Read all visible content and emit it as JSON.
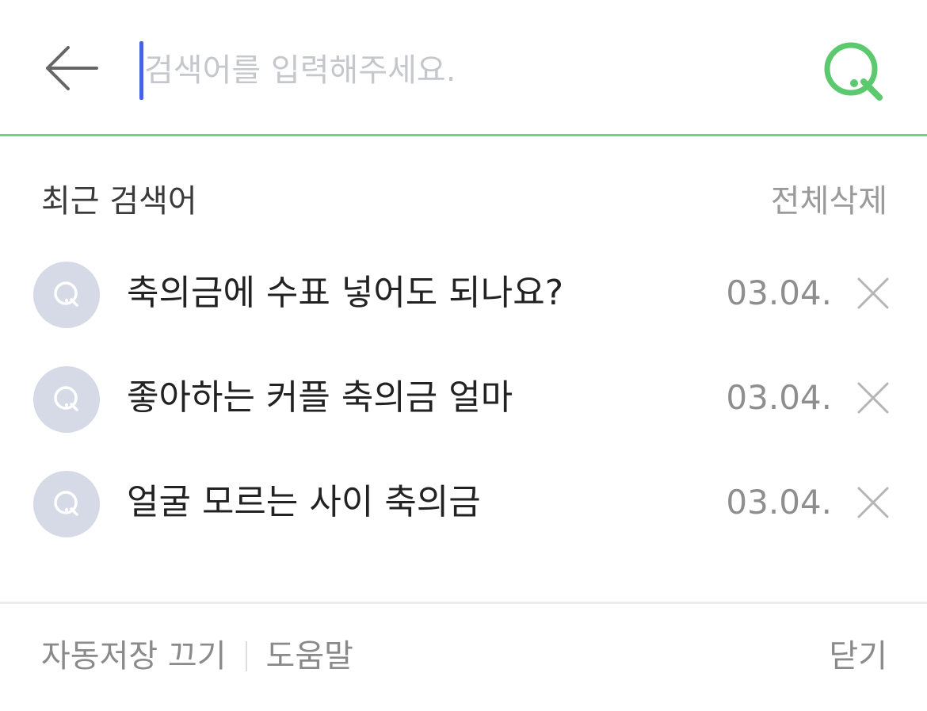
{
  "search": {
    "placeholder": "검색어를 입력해주세요.",
    "value": "",
    "back_icon": "arrow-left-icon",
    "search_icon": "search-icon",
    "accent_color": "#5cc96f",
    "caret_color": "#4563e3"
  },
  "recent": {
    "title": "최근 검색어",
    "delete_all_label": "전체삭제",
    "items": [
      {
        "query": "축의금에 수표 넣어도 되나요?",
        "date": "03.04.",
        "icon": "search-history-icon",
        "delete_icon": "close-icon"
      },
      {
        "query": "좋아하는 커플 축의금 얼마",
        "date": "03.04.",
        "icon": "search-history-icon",
        "delete_icon": "close-icon"
      },
      {
        "query": "얼굴 모르는 사이 축의금",
        "date": "03.04.",
        "icon": "search-history-icon",
        "delete_icon": "close-icon"
      }
    ]
  },
  "footer": {
    "autosave_off_label": "자동저장 끄기",
    "help_label": "도움말",
    "close_label": "닫기"
  }
}
